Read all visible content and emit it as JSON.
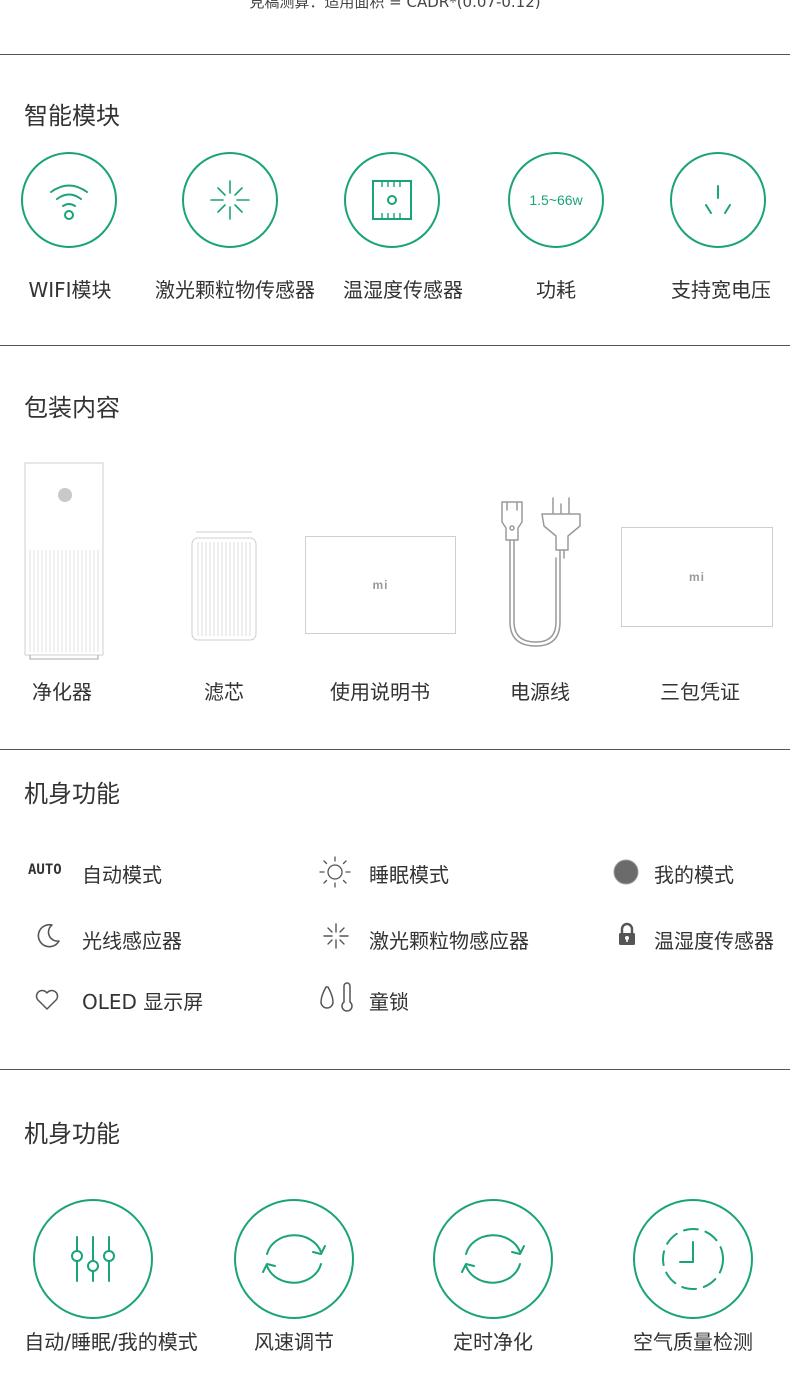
{
  "top_note": "見稿测算：适用面积 = CADR*(0.07-0.12)",
  "colors": {
    "accent": "#1aa37a",
    "text": "#333333",
    "divider": "#555555"
  },
  "smart": {
    "title": "智能模块",
    "items": [
      {
        "label": "WIFI模块",
        "icon": "wifi-icon"
      },
      {
        "label": "激光颗粒物传感器",
        "icon": "laser-sensor-icon"
      },
      {
        "label": "温湿度传感器",
        "icon": "chip-icon"
      },
      {
        "label": "功耗",
        "icon": "power-text-icon",
        "icon_text": "1.5~66w"
      },
      {
        "label": "支持宽电压",
        "icon": "plug-icon"
      }
    ]
  },
  "package": {
    "title": "包装内容",
    "items": [
      {
        "label": "净化器",
        "icon": "purifier-image"
      },
      {
        "label": "滤芯",
        "icon": "filter-image"
      },
      {
        "label": "使用说明书",
        "icon": "manual-image",
        "logo": "mi"
      },
      {
        "label": "电源线",
        "icon": "power-cord-image"
      },
      {
        "label": "三包凭证",
        "icon": "warranty-image",
        "logo": "mi"
      }
    ]
  },
  "body_functions": {
    "title": "机身功能",
    "rows": [
      [
        {
          "icon": "auto-icon",
          "icon_text": "AUTO",
          "label": "自动模式"
        },
        {
          "icon": "sun-icon",
          "label": "睡眠模式"
        },
        {
          "icon": "dot-icon",
          "label": "我的模式"
        }
      ],
      [
        {
          "icon": "moon-icon",
          "label": "光线感应器"
        },
        {
          "icon": "sparkle-icon",
          "label": "激光颗粒物感应器"
        },
        {
          "icon": "lock-icon",
          "label": "温湿度传感器"
        }
      ],
      [
        {
          "icon": "heart-icon",
          "label": "OLED 显示屏"
        },
        {
          "icon": "drop-thermo-icon",
          "label": "童锁"
        }
      ]
    ]
  },
  "body_functions_2": {
    "title": "机身功能",
    "items": [
      {
        "icon": "sliders-icon",
        "label": "自动/睡眠/我的模式"
      },
      {
        "icon": "refresh-icon",
        "label": "风速调节"
      },
      {
        "icon": "refresh-icon",
        "label": "定时净化"
      },
      {
        "icon": "clock-icon",
        "label": "空气质量检测"
      }
    ]
  }
}
